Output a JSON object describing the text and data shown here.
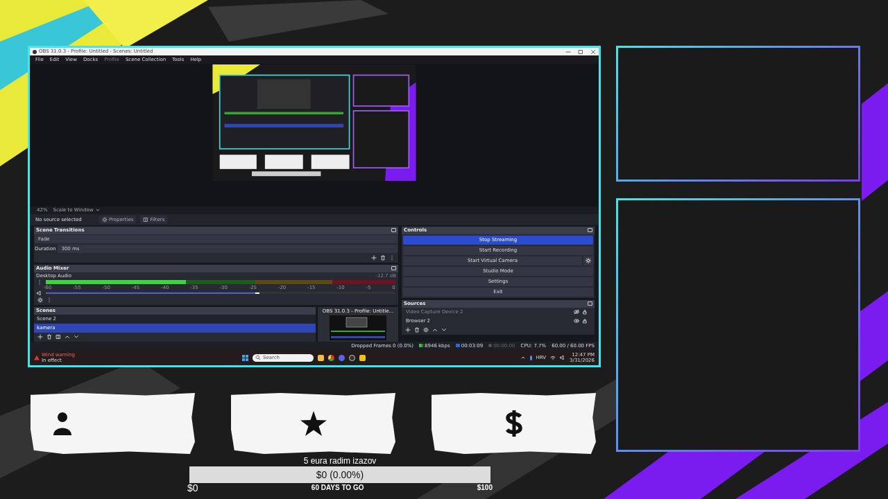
{
  "obs": {
    "title": "OBS 31.0.3 - Profile: Untitled - Scenes: Untitled",
    "menu": [
      {
        "label": "File",
        "disabled": false
      },
      {
        "label": "Edit",
        "disabled": false
      },
      {
        "label": "View",
        "disabled": false
      },
      {
        "label": "Docks",
        "disabled": false
      },
      {
        "label": "Profile",
        "disabled": true
      },
      {
        "label": "Scene Collection",
        "disabled": false
      },
      {
        "label": "Tools",
        "disabled": false
      },
      {
        "label": "Help",
        "disabled": false
      }
    ],
    "zoom": "42%",
    "scale_mode": "Scale to Window",
    "no_source": "No source selected",
    "properties": "Properties",
    "filters": "Filters",
    "transitions": {
      "title": "Scene Transitions",
      "type": "Fade",
      "duration_label": "Duration",
      "duration": "300 ms"
    },
    "mixer": {
      "title": "Audio Mixer",
      "channel": "Desktop Audio",
      "reading": "-12.7 dB",
      "ticks": [
        "-60",
        "-55",
        "-50",
        "-45",
        "-40",
        "-35",
        "-30",
        "-25",
        "-20",
        "-15",
        "-10",
        "-5",
        "0"
      ],
      "meter": {
        "level": 0.4
      },
      "volume": {
        "level": 0.6
      }
    },
    "scenes": {
      "title": "Scenes",
      "items": [
        {
          "label": "Scene 2",
          "selected": false
        },
        {
          "label": "kamera",
          "selected": true
        }
      ]
    },
    "controls": {
      "title": "Controls",
      "buttons": [
        {
          "label": "Stop Streaming",
          "selected": true,
          "settings": false
        },
        {
          "label": "Start Recording",
          "selected": false,
          "settings": false
        },
        {
          "label": "Start Virtual Camera",
          "selected": false,
          "settings": true
        },
        {
          "label": "Studio Mode",
          "selected": false,
          "settings": false
        },
        {
          "label": "Settings",
          "selected": false,
          "settings": false
        },
        {
          "label": "Exit",
          "selected": false,
          "settings": false
        }
      ]
    },
    "sources": {
      "title": "Sources",
      "items": [
        {
          "label": "Video Capture Device 2",
          "visible": false
        },
        {
          "label": "Browser 2",
          "visible": true
        }
      ]
    },
    "status": [
      {
        "kind": "dropped",
        "text": "Dropped Frames 0 (0.0%)",
        "active": true
      },
      {
        "kind": "bitrate",
        "text": "8946 kbps",
        "active": true
      },
      {
        "kind": "stream",
        "text": "00:03:09",
        "active": true
      },
      {
        "kind": "record",
        "text": "00:00:00",
        "active": false
      },
      {
        "kind": "cpu",
        "text": "CPU: 7.7%",
        "active": true
      },
      {
        "kind": "fps",
        "text": "60.00 / 60.00 FPS",
        "active": true
      }
    ],
    "thumbnail_title": "OBS 31.0.3 - Profile: Untitle..."
  },
  "taskbar": {
    "weather_title": "Wind warning",
    "weather_sub": "In effect",
    "search_placeholder": "Search",
    "language": "HRV",
    "time": "12:47 PM",
    "date": "3/31/2026"
  },
  "goal": {
    "title": "5 eura radim izazov",
    "progress_text": "$0 (0.00%)",
    "level": 0,
    "start": "$0",
    "days_left": "60 DAYS TO GO",
    "target": "$100"
  }
}
